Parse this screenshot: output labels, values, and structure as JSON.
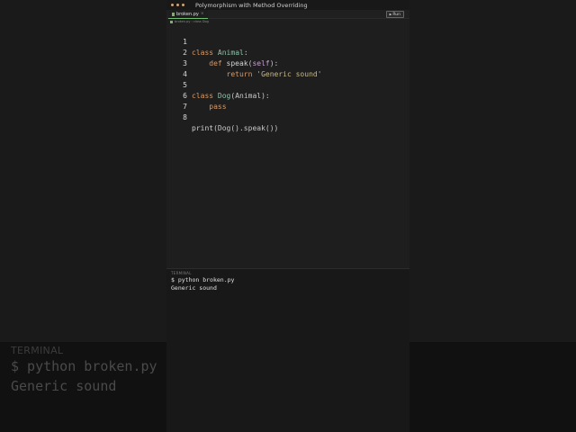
{
  "window": {
    "title": "Polymorphism with Method Overriding"
  },
  "tabs": [
    {
      "label": "broken.py",
      "close": "×"
    }
  ],
  "toolbar": {
    "run_label": "Run",
    "run_icon": "▶"
  },
  "breadcrumb": {
    "text": "broken.py › class Dog"
  },
  "editor": {
    "lines": [
      {
        "num": "1"
      },
      {
        "num": "2"
      },
      {
        "num": "3"
      },
      {
        "num": "4"
      },
      {
        "num": "5"
      },
      {
        "num": "6"
      },
      {
        "num": "7"
      },
      {
        "num": "8"
      }
    ],
    "tokens": {
      "l1_kw": "class",
      "l1_cls": "Animal",
      "l1_pun": ":",
      "l2_kw": "def",
      "l2_fn": "speak",
      "l2_p1": "(",
      "l2_self": "self",
      "l2_p2": "):",
      "l3_kw": "return",
      "l3_str": "'Generic sound'",
      "l5_kw": "class",
      "l5_cls": "Dog",
      "l5_p1": "(Animal):",
      "l6_kw": "pass",
      "l8_fn": "print",
      "l8_rest": "(Dog().speak())"
    }
  },
  "terminal": {
    "label": "TERMINAL",
    "lines": [
      "$ python broken.py",
      "Generic sound"
    ]
  },
  "icons": {
    "window_controls": "dot-icon",
    "file": "python-file-icon"
  },
  "colors": {
    "accent_keyword": "#d79b6b",
    "class_name": "#8fc1a9",
    "string": "#c7b98a",
    "tab_underline": "#6fbf73"
  }
}
